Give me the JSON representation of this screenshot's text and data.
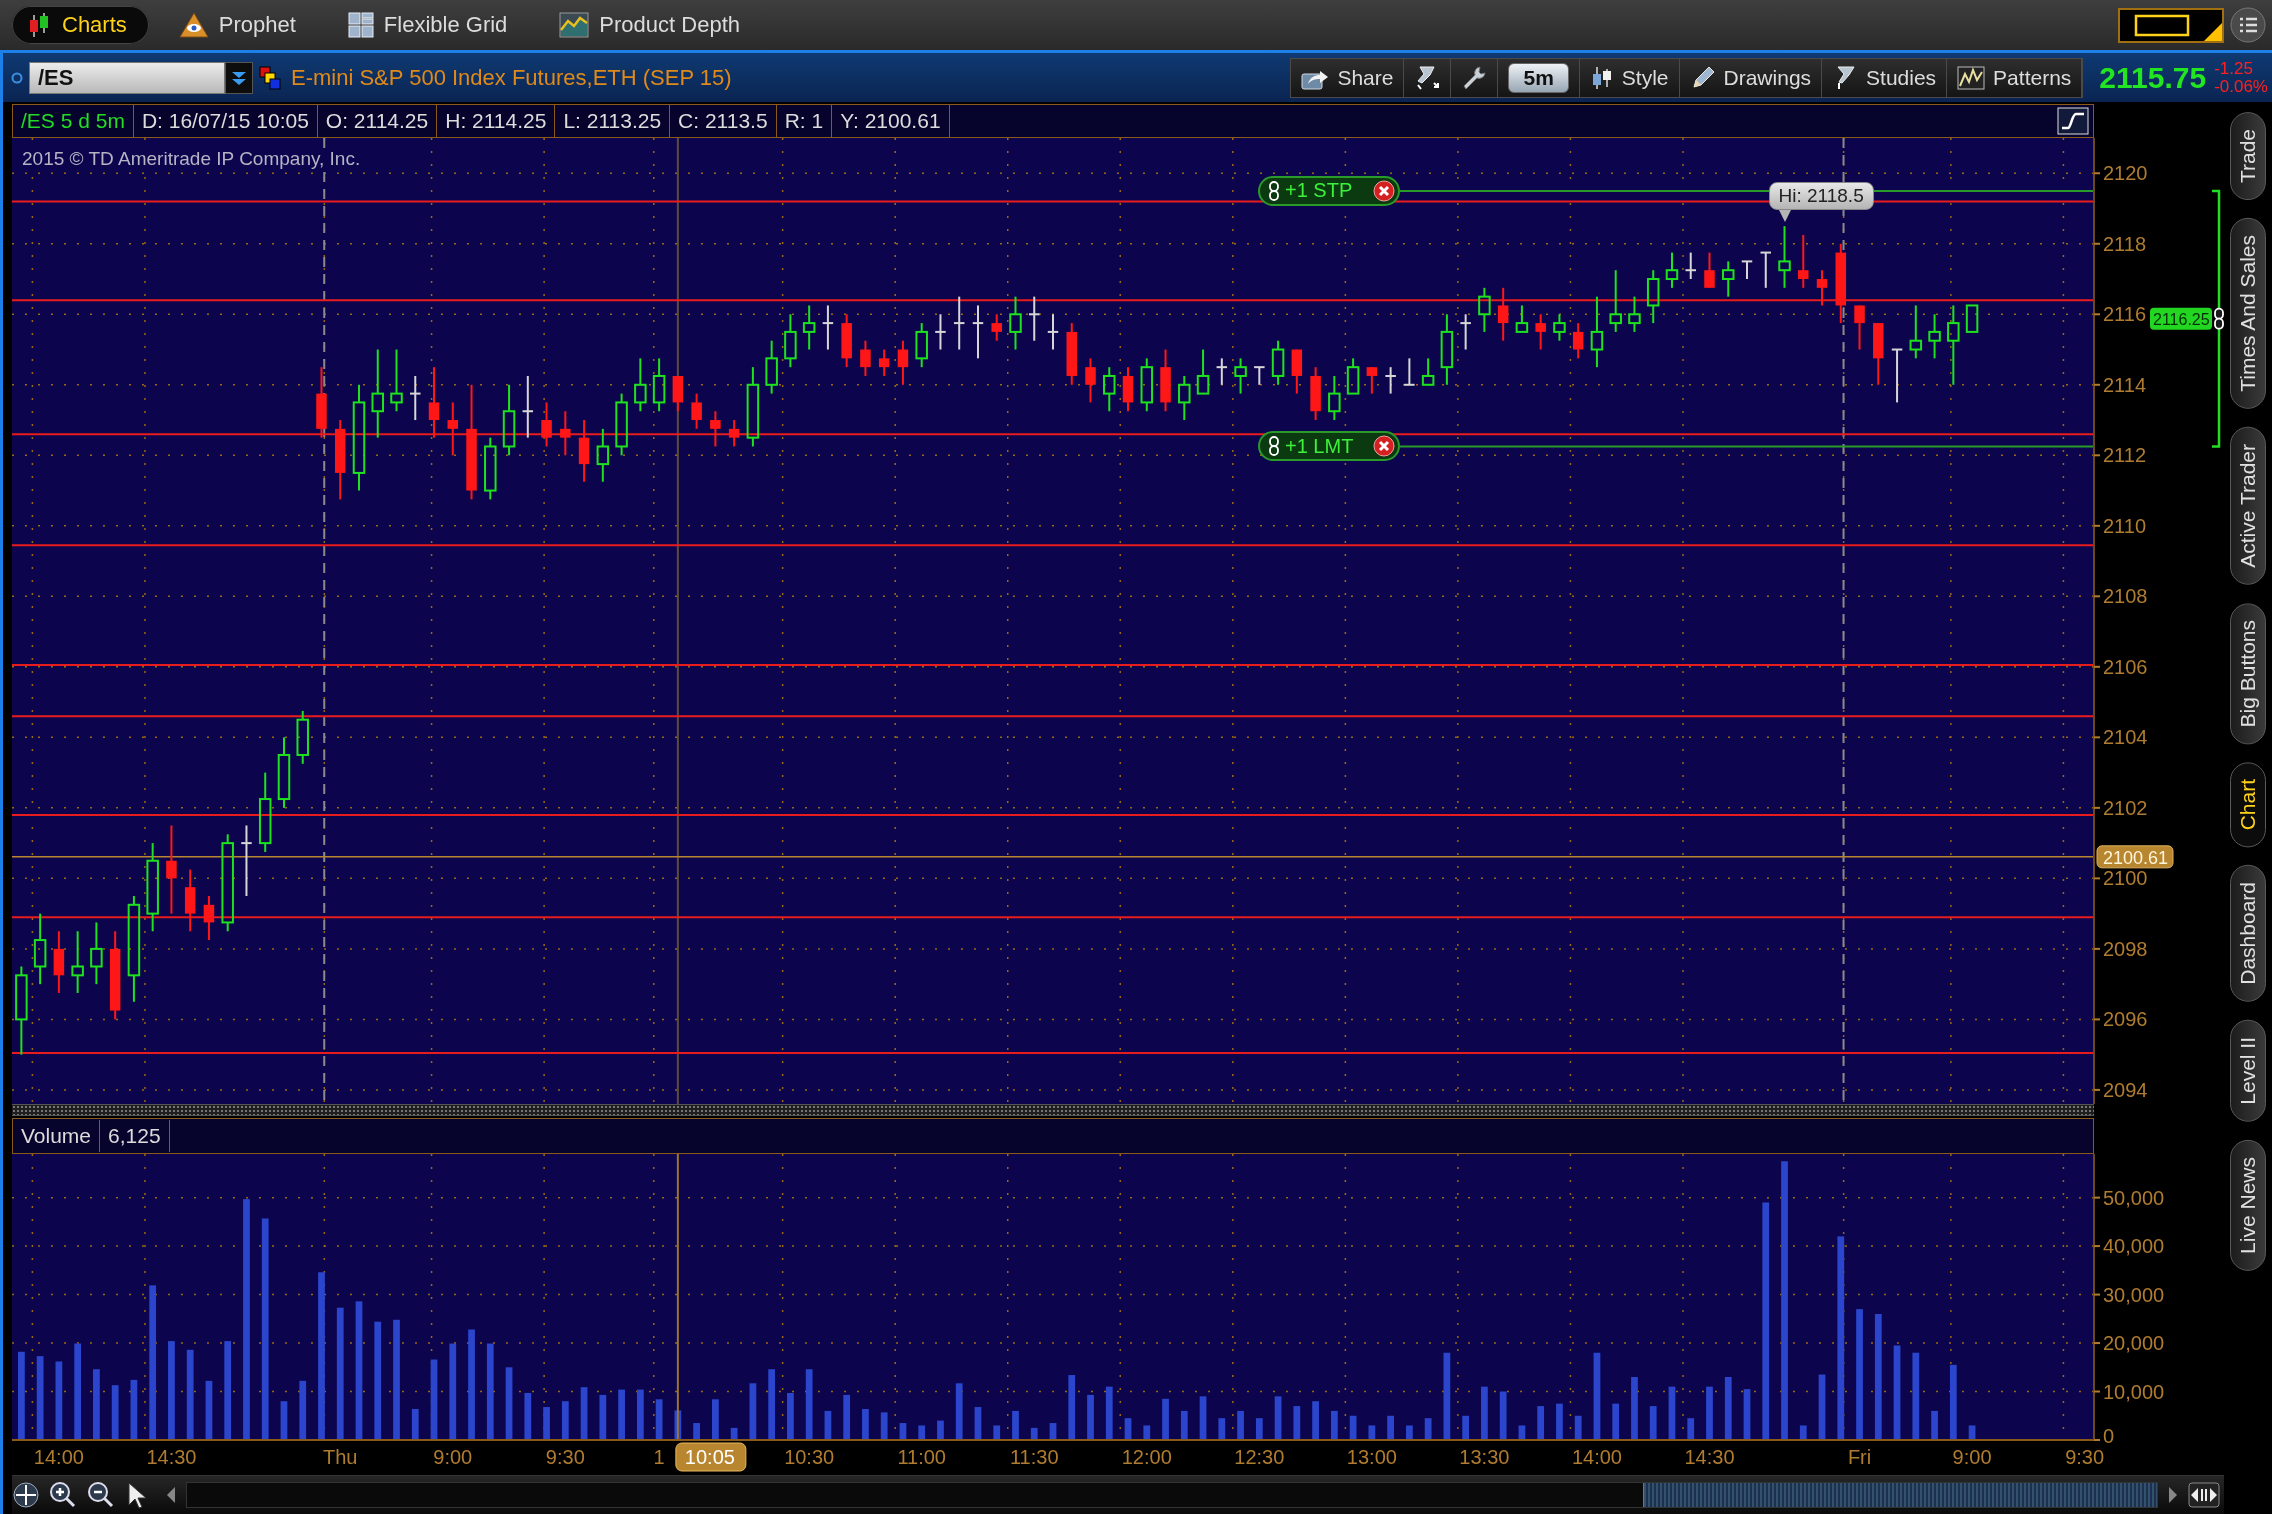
{
  "app_tabs": [
    {
      "label": "Charts",
      "selected": true
    },
    {
      "label": "Prophet",
      "selected": false
    },
    {
      "label": "Flexible Grid",
      "selected": false
    },
    {
      "label": "Product Depth",
      "selected": false
    }
  ],
  "symbol": {
    "value": "/ES",
    "description": "E-mini S&P 500 Index Futures,ETH (SEP 15)"
  },
  "toolbar": [
    {
      "kind": "share",
      "label": "Share"
    },
    {
      "kind": "edit_studies"
    },
    {
      "kind": "settings"
    },
    {
      "kind": "interval",
      "label": "5m"
    },
    {
      "kind": "style",
      "label": "Style"
    },
    {
      "kind": "drawings",
      "label": "Drawings"
    },
    {
      "kind": "studies",
      "label": "Studies"
    },
    {
      "kind": "patterns",
      "label": "Patterns"
    }
  ],
  "quote": {
    "last": "2115.75",
    "change": "-1.25",
    "percent": "-0.06%"
  },
  "readout": {
    "study": "/ES 5 d 5m",
    "fields": [
      "D: 16/07/15 10:05",
      "O: 2114.25",
      "H: 2114.25",
      "L: 2113.25",
      "C: 2113.5",
      "R: 1",
      "Y: 2100.61"
    ]
  },
  "price_pane": {
    "copyright": "2015 © TD Ameritrade IP Company, Inc.",
    "orders": [
      {
        "label": "+1 STP"
      },
      {
        "label": "+1 LMT"
      }
    ],
    "bracket": {
      "label": "2116.25"
    },
    "chart_data": [
      {
        "type": "candlestick",
        "ohlc": [
          [
            2096,
            2097.5,
            2095,
            2097.25
          ],
          [
            2097.5,
            2099,
            2097,
            2098.25
          ],
          [
            2098,
            2098.5,
            2096.75,
            2097.25
          ],
          [
            2097.25,
            2098.5,
            2096.75,
            2097.5
          ],
          [
            2097.5,
            2098.75,
            2097,
            2098
          ],
          [
            2098,
            2098.5,
            2096,
            2096.25
          ],
          [
            2097.25,
            2099.5,
            2096.5,
            2099.25
          ],
          [
            2099,
            2101,
            2098.5,
            2100.5
          ],
          [
            2100.5,
            2101.5,
            2099,
            2100
          ],
          [
            2099.75,
            2100.25,
            2098.5,
            2099
          ],
          [
            2099.25,
            2099.5,
            2098.25,
            2098.75
          ],
          [
            2098.75,
            2101.25,
            2098.5,
            2101
          ],
          [
            2101,
            2101.5,
            2099.5,
            2101
          ],
          [
            2101,
            2103,
            2100.75,
            2102.25
          ],
          [
            2102.25,
            2104,
            2102,
            2103.5
          ],
          [
            2103.5,
            2104.75,
            2103.25,
            2104.5
          ],
          [
            2113.75,
            2114.5,
            2112.5,
            2112.75
          ],
          [
            2112.75,
            2113,
            2110.75,
            2111.5
          ],
          [
            2111.5,
            2114,
            2111,
            2113.5
          ],
          [
            2113.25,
            2115,
            2112.5,
            2113.75
          ],
          [
            2113.5,
            2115,
            2113.25,
            2113.75
          ],
          [
            2113.75,
            2114.25,
            2113,
            2113.75
          ],
          [
            2113.5,
            2114.5,
            2112.5,
            2113
          ],
          [
            2113,
            2113.5,
            2112,
            2112.75
          ],
          [
            2112.75,
            2114,
            2110.75,
            2111
          ],
          [
            2111,
            2112.5,
            2110.75,
            2112.25
          ],
          [
            2112.25,
            2114,
            2112,
            2113.25
          ],
          [
            2113.25,
            2114.25,
            2112.5,
            2113.25
          ],
          [
            2113,
            2113.5,
            2112.25,
            2112.5
          ],
          [
            2112.75,
            2113.25,
            2112,
            2112.5
          ],
          [
            2112.5,
            2113,
            2111.25,
            2111.75
          ],
          [
            2111.75,
            2112.75,
            2111.25,
            2112.25
          ],
          [
            2112.25,
            2113.75,
            2112,
            2113.5
          ],
          [
            2113.5,
            2114.75,
            2113.25,
            2114
          ],
          [
            2113.5,
            2114.75,
            2113.25,
            2114.25
          ],
          [
            2114.25,
            2114.25,
            2113.25,
            2113.5
          ],
          [
            2113.5,
            2113.75,
            2112.75,
            2113
          ],
          [
            2113,
            2113.25,
            2112.25,
            2112.75
          ],
          [
            2112.75,
            2113,
            2112.25,
            2112.5
          ],
          [
            2112.5,
            2114.5,
            2112.25,
            2114
          ],
          [
            2114,
            2115.25,
            2113.75,
            2114.75
          ],
          [
            2114.75,
            2116,
            2114.5,
            2115.5
          ],
          [
            2115.5,
            2116.25,
            2115,
            2115.75
          ],
          [
            2115.75,
            2116.25,
            2115,
            2115.75
          ],
          [
            2115.75,
            2116,
            2114.5,
            2114.75
          ],
          [
            2115,
            2115.25,
            2114.25,
            2114.5
          ],
          [
            2114.75,
            2115,
            2114.25,
            2114.5
          ],
          [
            2115,
            2115.25,
            2114,
            2114.5
          ],
          [
            2114.75,
            2115.75,
            2114.5,
            2115.5
          ],
          [
            2115.5,
            2116,
            2115,
            2115.5
          ],
          [
            2115.75,
            2116.5,
            2115,
            2115.75
          ],
          [
            2115.75,
            2116.25,
            2114.75,
            2115.75
          ],
          [
            2115.75,
            2116,
            2115.25,
            2115.5
          ],
          [
            2115.5,
            2116.5,
            2115,
            2116
          ],
          [
            2116,
            2116.5,
            2115.25,
            2116
          ],
          [
            2115.5,
            2116,
            2115,
            2115.5
          ],
          [
            2115.5,
            2115.75,
            2114,
            2114.25
          ],
          [
            2114.5,
            2114.75,
            2113.5,
            2114
          ],
          [
            2113.75,
            2114.5,
            2113.25,
            2114.25
          ],
          [
            2114.25,
            2114.5,
            2113.25,
            2113.5
          ],
          [
            2113.5,
            2114.75,
            2113.25,
            2114.5
          ],
          [
            2114.5,
            2115,
            2113.25,
            2113.5
          ],
          [
            2113.5,
            2114.25,
            2113,
            2114
          ],
          [
            2113.75,
            2115,
            2113.75,
            2114.25
          ],
          [
            2114.5,
            2114.75,
            2114,
            2114.5
          ],
          [
            2114.25,
            2114.75,
            2113.75,
            2114.5
          ],
          [
            2114.5,
            2114.5,
            2114,
            2114.5
          ],
          [
            2114.25,
            2115.25,
            2114,
            2115
          ],
          [
            2115,
            2115,
            2113.75,
            2114.25
          ],
          [
            2114.25,
            2114.5,
            2113,
            2113.25
          ],
          [
            2113.25,
            2114.25,
            2113,
            2113.75
          ],
          [
            2113.75,
            2114.75,
            2113.75,
            2114.5
          ],
          [
            2114.5,
            2114.5,
            2113.75,
            2114.25
          ],
          [
            2114.25,
            2114.5,
            2113.75,
            2114.25
          ],
          [
            2114,
            2114.75,
            2114,
            2114
          ],
          [
            2114,
            2114.75,
            2114,
            2114.25
          ],
          [
            2114.5,
            2116,
            2114,
            2115.5
          ],
          [
            2115.75,
            2116,
            2115,
            2115.75
          ],
          [
            2116,
            2116.75,
            2115.5,
            2116.5
          ],
          [
            2116.25,
            2116.75,
            2115.25,
            2115.75
          ],
          [
            2115.5,
            2116.25,
            2115.5,
            2115.75
          ],
          [
            2115.75,
            2116,
            2115,
            2115.5
          ],
          [
            2115.5,
            2116,
            2115.25,
            2115.75
          ],
          [
            2115.5,
            2115.75,
            2114.75,
            2115
          ],
          [
            2115,
            2116.5,
            2114.5,
            2115.5
          ],
          [
            2115.75,
            2117.25,
            2115.5,
            2116
          ],
          [
            2115.75,
            2116.5,
            2115.5,
            2116
          ],
          [
            2116.25,
            2117.25,
            2115.75,
            2117
          ],
          [
            2117,
            2117.75,
            2116.75,
            2117.25
          ],
          [
            2117.25,
            2117.75,
            2117,
            2117.25
          ],
          [
            2117.25,
            2117.75,
            2116.75,
            2116.75
          ],
          [
            2117,
            2117.5,
            2116.5,
            2117.25
          ],
          [
            2117.5,
            2117.5,
            2117,
            2117.5
          ],
          [
            2117.75,
            2117.75,
            2116.75,
            2117.75
          ],
          [
            2117.25,
            2118.5,
            2116.75,
            2117.5
          ],
          [
            2117.25,
            2118.25,
            2116.75,
            2117
          ],
          [
            2117,
            2117.25,
            2116.25,
            2116.75
          ],
          [
            2117.75,
            2118,
            2115.75,
            2116.25
          ],
          [
            2116.25,
            2116.25,
            2115,
            2115.75
          ],
          [
            2115.75,
            2115.75,
            2114,
            2114.75
          ],
          [
            2115,
            2115,
            2113.5,
            2115
          ],
          [
            2115,
            2116.25,
            2114.75,
            2115.25
          ],
          [
            2115.25,
            2116,
            2114.75,
            2115.5
          ],
          [
            2115.25,
            2116.25,
            2114,
            2115.75
          ],
          [
            2115.5,
            2116.25,
            2115.5,
            2116.25
          ],
          null,
          null,
          null,
          null,
          null,
          null
        ],
        "ylim": [
          2093.6,
          2121
        ],
        "yticks": [
          2094,
          2096,
          2098,
          2100,
          2102,
          2104,
          2106,
          2108,
          2110,
          2112,
          2114,
          2116,
          2118,
          2120
        ],
        "grid": true,
        "ref_lines": [
          {
            "axis": "y",
            "value": 2119.5,
            "color": "#2a9a2a"
          },
          {
            "axis": "y",
            "value": 2112.25,
            "color": "#2a9a2a"
          },
          {
            "axis": "y",
            "value": 2119.2,
            "color": "#e81c1c"
          },
          {
            "axis": "y",
            "value": 2116.4,
            "color": "#e81c1c"
          },
          {
            "axis": "y",
            "value": 2112.6,
            "color": "#e81c1c"
          },
          {
            "axis": "y",
            "value": 2109.45,
            "color": "#e81c1c"
          },
          {
            "axis": "y",
            "value": 2106.05,
            "color": "#e81c1c"
          },
          {
            "axis": "y",
            "value": 2104.6,
            "color": "#e81c1c"
          },
          {
            "axis": "y",
            "value": 2101.8,
            "color": "#e81c1c"
          },
          {
            "axis": "y",
            "value": 2098.9,
            "color": "#e81c1c"
          },
          {
            "axis": "y",
            "value": 2095.05,
            "color": "#e81c1c"
          },
          {
            "axis": "y",
            "value": 2100.61,
            "label": "2100.61",
            "color": "#b8862f"
          }
        ],
        "annotations": [
          "Hi: 2118.5"
        ]
      }
    ]
  },
  "volume_pane": {
    "title": "Volume",
    "reading": "6,125",
    "cursor_label": "10:05",
    "chart_data": [
      {
        "type": "bar",
        "categories": [
          null,
          null,
          "14:00",
          null,
          null,
          null,
          null,
          null,
          "14:30",
          null,
          null,
          null,
          null,
          null,
          null,
          null,
          null,
          "Thu",
          null,
          null,
          null,
          null,
          null,
          "9:00",
          null,
          null,
          null,
          null,
          null,
          "9:30",
          null,
          null,
          null,
          null,
          "1",
          null,
          null,
          null,
          null,
          null,
          null,
          null,
          "10:30",
          null,
          null,
          null,
          null,
          null,
          "11:00",
          null,
          null,
          null,
          null,
          null,
          "11:30",
          null,
          null,
          null,
          null,
          null,
          "12:00",
          null,
          null,
          null,
          null,
          null,
          "12:30",
          null,
          null,
          null,
          null,
          null,
          "13:00",
          null,
          null,
          null,
          null,
          null,
          "13:30",
          null,
          null,
          null,
          null,
          null,
          "14:00",
          null,
          null,
          null,
          null,
          null,
          "14:30",
          null,
          null,
          null,
          null,
          null,
          null,
          null,
          "Fri",
          null,
          null,
          null,
          null,
          null,
          "9:00",
          null,
          null,
          null,
          null,
          null,
          "9:30"
        ],
        "values": [
          18200,
          17300,
          16200,
          19900,
          14600,
          11300,
          12400,
          31900,
          20400,
          18600,
          12200,
          20400,
          49700,
          45700,
          8000,
          12200,
          34600,
          27300,
          28600,
          24400,
          24800,
          6400,
          16600,
          19900,
          22800,
          19900,
          15000,
          9700,
          6800,
          8000,
          10900,
          9300,
          10400,
          10400,
          8400,
          6100,
          3500,
          8400,
          2500,
          11700,
          14600,
          9700,
          14600,
          6000,
          9300,
          6400,
          5700,
          3500,
          3000,
          4000,
          11700,
          6800,
          3000,
          6000,
          2500,
          3500,
          13400,
          9300,
          11000,
          4500,
          3000,
          8500,
          6000,
          9000,
          4500,
          6000,
          4500,
          9000,
          7000,
          8000,
          6000,
          5000,
          3000,
          5000,
          3000,
          4500,
          18000,
          5000,
          11000,
          10000,
          3000,
          7000,
          7500,
          5000,
          18000,
          7500,
          13000,
          7000,
          11000,
          4500,
          11000,
          13000,
          10500,
          49000,
          57500,
          3000,
          13500,
          42000,
          27000,
          26000,
          19500,
          18000,
          6000,
          15500,
          3000,
          null,
          null,
          null,
          null,
          null,
          null
        ],
        "color": "#2b46cc",
        "ylim": [
          0,
          59000
        ],
        "yticks": [
          {
            "value": 0,
            "label": "0"
          },
          {
            "value": 10000,
            "label": "10,000"
          },
          {
            "value": 20000,
            "label": "20,000"
          },
          {
            "value": 30000,
            "label": "30,000"
          },
          {
            "value": 40000,
            "label": "40,000"
          },
          {
            "value": 50000,
            "label": "50,000"
          }
        ],
        "grid": true
      }
    ]
  },
  "side_tabs": [
    {
      "label": "Trade",
      "selected": false
    },
    {
      "label": "Times And Sales",
      "selected": false
    },
    {
      "label": "Active Trader",
      "selected": false
    },
    {
      "label": "Big Buttons",
      "selected": false
    },
    {
      "label": "Chart",
      "selected": true
    },
    {
      "label": "Dashboard",
      "selected": false
    },
    {
      "label": "Level II",
      "selected": false
    },
    {
      "label": "Live News",
      "selected": false
    }
  ]
}
